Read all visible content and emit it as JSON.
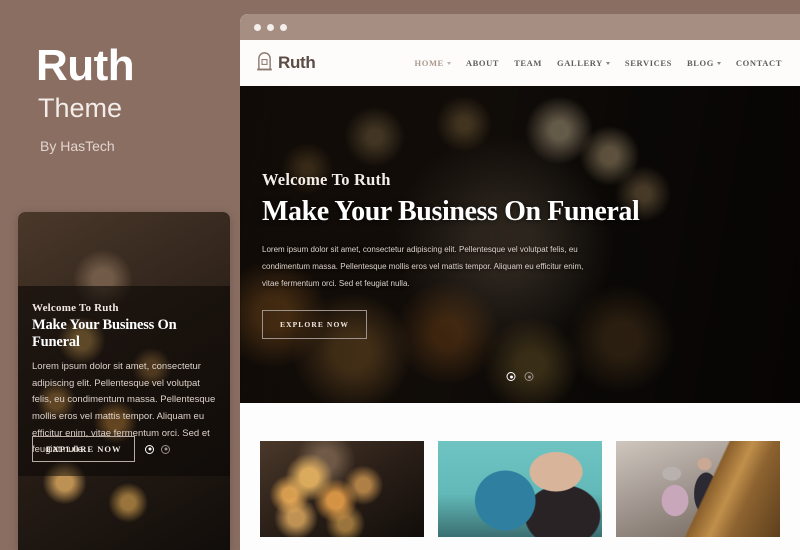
{
  "promo": {
    "title": "Ruth",
    "subtitle": "Theme",
    "author": "By HasTech"
  },
  "brand": {
    "name": "Ruth",
    "logo_icon": "gravestone-icon"
  },
  "nav": {
    "items": [
      {
        "label": "HOME",
        "has_dropdown": true,
        "active": true
      },
      {
        "label": "ABOUT",
        "has_dropdown": false,
        "active": false
      },
      {
        "label": "TEAM",
        "has_dropdown": false,
        "active": false
      },
      {
        "label": "GALLERY",
        "has_dropdown": true,
        "active": false
      },
      {
        "label": "SERVICES",
        "has_dropdown": false,
        "active": false
      },
      {
        "label": "BLOG",
        "has_dropdown": true,
        "active": false
      },
      {
        "label": "CONTACT",
        "has_dropdown": false,
        "active": false
      }
    ],
    "mobile_menu_icon": "hamburger-icon"
  },
  "hero": {
    "eyebrow": "Welcome To Ruth",
    "heading": "Make Your Business On Funeral",
    "paragraph": "Lorem ipsum dolor sit amet, consectetur adipiscing elit. Pellentesque vel volutpat felis, eu condimentum massa. Pellentesque mollis eros vel mattis tempor. Aliquam eu efficitur enim, vitae fermentum orci. Sed et feugiat nulla.",
    "cta_label": "EXPLORE NOW",
    "slides": [
      {
        "index": 1,
        "active": true
      },
      {
        "index": 2,
        "active": false
      }
    ]
  },
  "services": {
    "cards": [
      {
        "name": "candles-memorial-photo"
      },
      {
        "name": "urn-consultation-photo"
      },
      {
        "name": "coffin-selection-photo"
      }
    ]
  },
  "window_chrome": {
    "dots": 3,
    "bar_color": "#a78e83"
  },
  "colors": {
    "page_background": "#8a6e62",
    "chrome_bar": "#a78e83",
    "brand_text": "#5b4c46",
    "nav_active": "#a9988e"
  }
}
